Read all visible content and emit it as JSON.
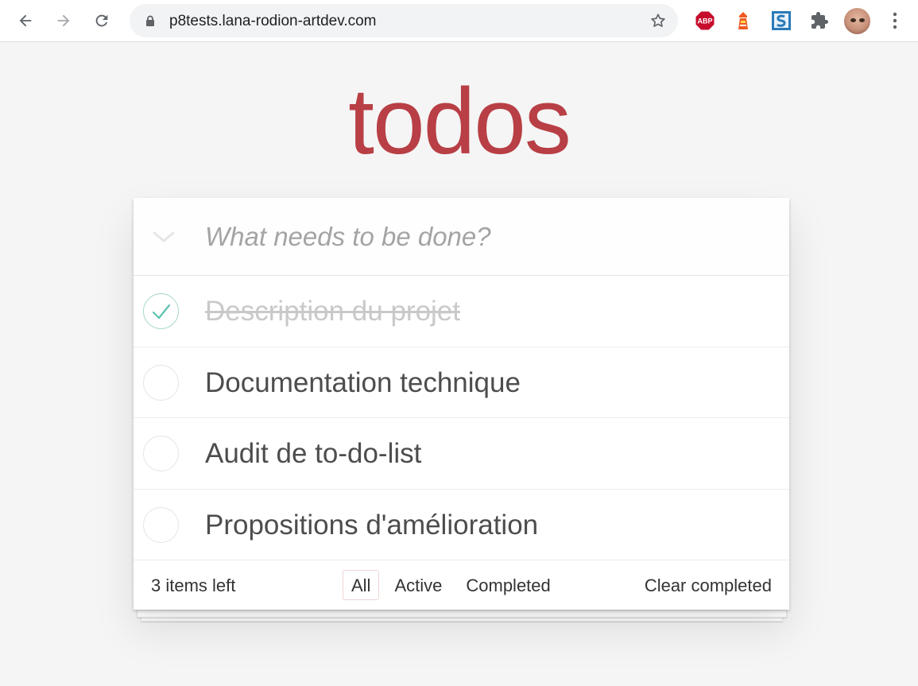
{
  "browser": {
    "url": "p8tests.lana-rodion-artdev.com",
    "extensions": [
      {
        "name": "adblock-plus",
        "text": "ABP",
        "color": "#c70d2c"
      },
      {
        "name": "lighthouse",
        "color": "#f05a22"
      },
      {
        "name": "s-extension",
        "color": "#2b7bb9"
      },
      {
        "name": "puzzle",
        "color": "#5f6368"
      }
    ]
  },
  "app": {
    "title": "todos",
    "accent_color": "#b83f45",
    "new_todo_placeholder": "What needs to be done?",
    "items": [
      {
        "label": "Description du projet",
        "completed": true
      },
      {
        "label": "Documentation technique",
        "completed": false
      },
      {
        "label": "Audit de to-do-list",
        "completed": false
      },
      {
        "label": "Propositions d'amélioration",
        "completed": false
      }
    ],
    "footer": {
      "count": "3 items left",
      "filters": [
        "All",
        "Active",
        "Completed"
      ],
      "selected_filter": "All",
      "clear_label": "Clear completed"
    }
  }
}
